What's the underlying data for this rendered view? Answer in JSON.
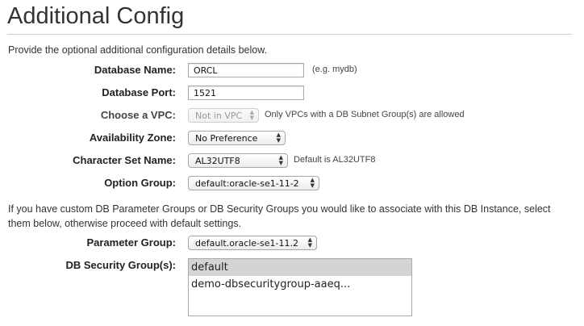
{
  "header": {
    "title": "Additional Config",
    "intro": "Provide the optional additional configuration details below."
  },
  "fields": {
    "db_name": {
      "label": "Database Name:",
      "value": "ORCL",
      "hint": "(e.g. mydb)"
    },
    "db_port": {
      "label": "Database Port:",
      "value": "1521"
    },
    "vpc": {
      "label": "Choose a VPC:",
      "value": "Not in VPC",
      "hint": "Only VPCs with a DB Subnet Group(s) are allowed",
      "disabled": true
    },
    "az": {
      "label": "Availability Zone:",
      "value": "No Preference"
    },
    "charset": {
      "label": "Character Set Name:",
      "value": "AL32UTF8",
      "hint": "Default is AL32UTF8"
    },
    "option_group": {
      "label": "Option Group:",
      "value": "default:oracle-se1-11-2"
    }
  },
  "paragraph": "If you have custom DB Parameter Groups or DB Security Groups you would like to associate with this DB Instance, select them below, otherwise proceed with default settings.",
  "param_group": {
    "label": "Parameter Group:",
    "value": "default.oracle-se1-11.2"
  },
  "security_groups": {
    "label": "DB Security Group(s):",
    "options": [
      "default",
      "demo-dbsecuritygroup-aaeq..."
    ],
    "selected_index": 0
  },
  "colors": {
    "selected_bg": "#d4d4d4",
    "rule": "#cfcfcf"
  }
}
